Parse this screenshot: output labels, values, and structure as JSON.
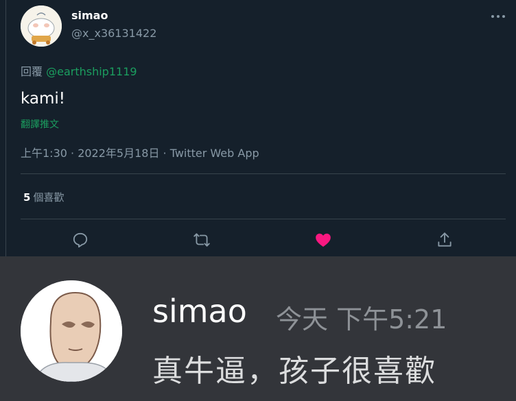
{
  "tweet": {
    "author_name": "simao",
    "author_handle": "@x_x36131422",
    "reply_prefix": "回覆",
    "reply_to": "@earthship1119",
    "content": "kami!",
    "translate_label": "翻譯推文",
    "meta": "上午1:30 · 2022年5月18日 · Twitter Web App",
    "like_count": "5",
    "like_label": "個喜歡",
    "liked": true,
    "colors": {
      "bg": "#15202b",
      "muted": "#8899a6",
      "link": "#1b9e5f",
      "heart": "#f91880"
    },
    "icons": [
      "more-icon",
      "reply-icon",
      "retweet-icon",
      "heart-icon",
      "share-icon"
    ]
  },
  "chat": {
    "author_name": "simao",
    "timestamp": "今天 下午5:21",
    "message": "真牛逼，孩子很喜歡",
    "colors": {
      "bg": "#33353a",
      "muted": "#8e9297"
    }
  }
}
